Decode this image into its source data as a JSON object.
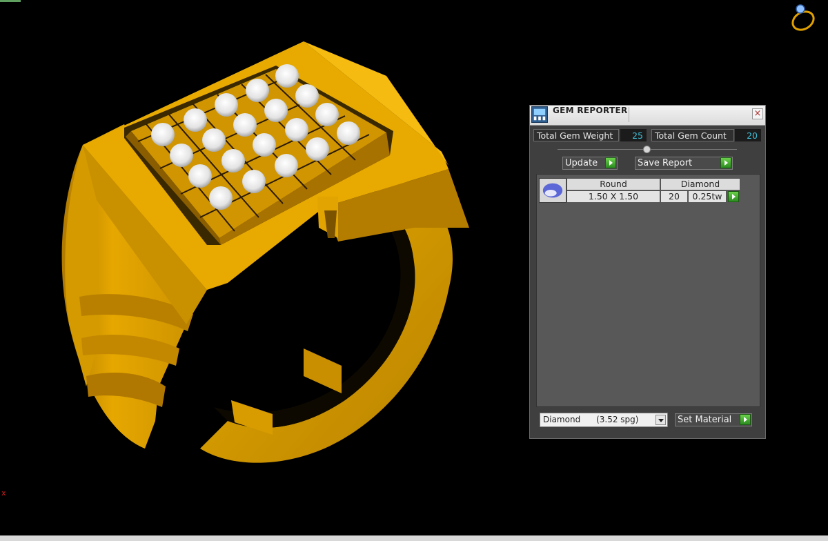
{
  "panel": {
    "title": "GEM REPORTER",
    "close_symbol": "×",
    "total_gem_weight_label": "Total Gem Weight",
    "total_gem_weight_value": "25",
    "total_gem_count_label": "Total Gem Count",
    "total_gem_count_value": "20",
    "update_label": "Update",
    "save_report_label": "Save Report",
    "gem_rows": [
      {
        "shape": "Round",
        "material": "Diamond",
        "size": "1.50 X 1.50",
        "count": "20",
        "weight": "0.25tw"
      }
    ],
    "material_select_value": "Diamond      (3.52 spg)",
    "set_material_label": "Set Material"
  },
  "viewport": {
    "axis_marker": "x"
  },
  "icons": {
    "app": "gem-reporter-app-icon",
    "close": "close-icon",
    "play": "green-play-icon",
    "gem": "round-gem-icon",
    "dropdown": "chevron-down-icon",
    "logo": "ring-logo-icon"
  },
  "colors": {
    "metal": "#e0a000",
    "panel_bg": "#3f3f3f",
    "value_text": "#3fc0d8",
    "accent_green": "#3aa52a"
  }
}
